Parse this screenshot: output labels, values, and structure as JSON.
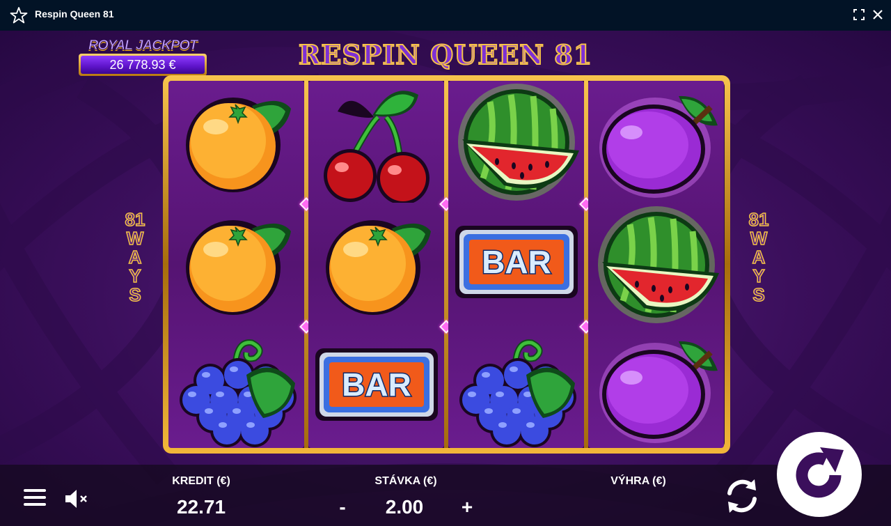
{
  "window": {
    "title": "Respin Queen 81",
    "star_icon": "star-icon",
    "fullscreen_icon": "fullscreen-icon",
    "close_icon": "close-icon"
  },
  "jackpot": {
    "label": "ROYAL JACKPOT",
    "amount": "26 778.93 €"
  },
  "game_title": "RESPIN QUEEN 81",
  "ways": {
    "number": "81",
    "word": "WAYS"
  },
  "reels": [
    [
      "orange",
      "orange",
      "grapes"
    ],
    [
      "cherries",
      "orange",
      "bar"
    ],
    [
      "watermelon",
      "bar",
      "grapes"
    ],
    [
      "plum",
      "watermelon",
      "plum"
    ]
  ],
  "symbol_text": {
    "bar": "BAR"
  },
  "controls": {
    "credit_label": "KREDIT (€)",
    "credit_value": "22.71",
    "bet_label": "STÁVKA (€)",
    "bet_value": "2.00",
    "bet_minus": "-",
    "bet_plus": "+",
    "win_label": "VÝHRA (€)",
    "win_value": "",
    "menu_icon": "hamburger-menu-icon",
    "sound_icon": "speaker-muted-icon",
    "autoplay_icon": "autoplay-arrows-icon",
    "spin_icon": "spin-arrow-icon"
  },
  "colors": {
    "gold": "#f5c344",
    "purple": "#5a1f82",
    "titlebar": "#021326"
  }
}
